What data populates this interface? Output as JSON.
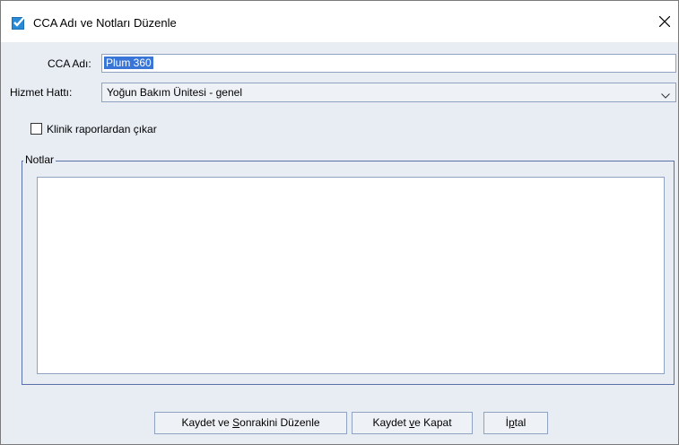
{
  "window": {
    "title": "CCA Adı ve Notları Düzenle"
  },
  "form": {
    "cca_name_label": "CCA Adı:",
    "cca_name_value": "Plum 360",
    "service_line_label": "Hizmet Hattı:",
    "service_line_value": "Yoğun Bakım Ünitesi - genel",
    "exclude_checkbox_label": "Klinik raporlardan çıkar",
    "exclude_checked": false
  },
  "notes": {
    "legend": "Notlar",
    "value": ""
  },
  "buttons": {
    "save_next": {
      "pre": "Kaydet ve ",
      "key": "S",
      "post": "onrakini Düzenle"
    },
    "save_close": {
      "pre": "Kaydet ",
      "key": "v",
      "post": "e Kapat"
    },
    "cancel": {
      "pre": "İ",
      "key": "p",
      "post": "tal"
    }
  },
  "colors": {
    "accent": "#3875d7",
    "checkmark": "#1e90d6",
    "background": "#e8edf4",
    "border": "#8fa2bf"
  }
}
